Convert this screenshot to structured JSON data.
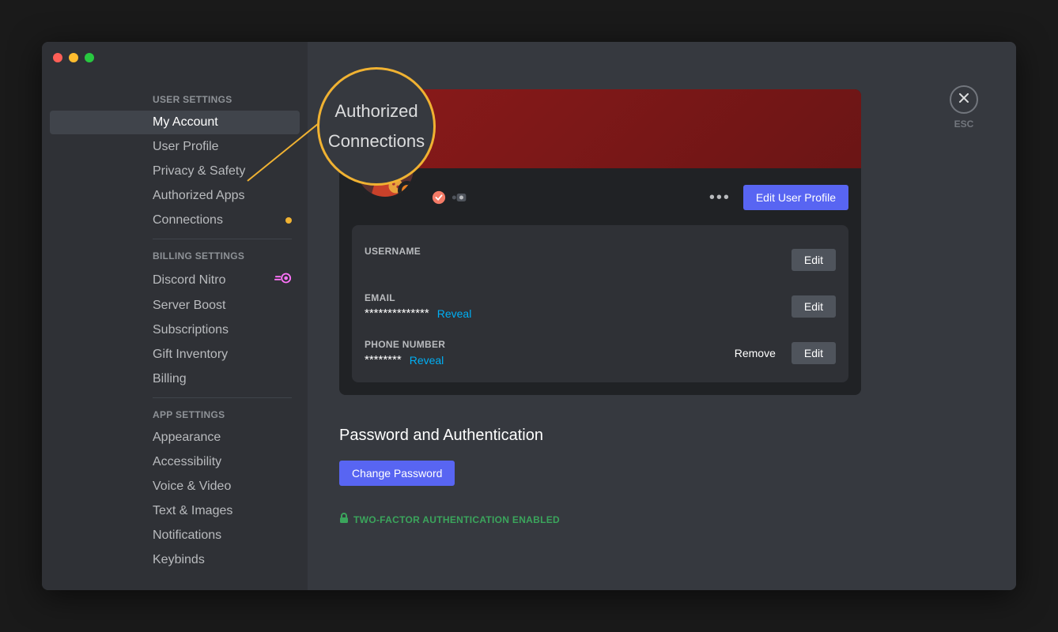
{
  "sidebar": {
    "userSettingsHeader": "User Settings",
    "billingSettingsHeader": "Billing Settings",
    "appSettingsHeader": "App Settings",
    "items": {
      "myAccount": "My Account",
      "userProfile": "User Profile",
      "privacySafety": "Privacy & Safety",
      "authorizedApps": "Authorized Apps",
      "connections": "Connections",
      "discordNitro": "Discord Nitro",
      "serverBoost": "Server Boost",
      "subscriptions": "Subscriptions",
      "giftInventory": "Gift Inventory",
      "billing": "Billing",
      "appearance": "Appearance",
      "accessibility": "Accessibility",
      "voiceVideo": "Voice & Video",
      "textImages": "Text & Images",
      "notifications": "Notifications",
      "keybinds": "Keybinds"
    }
  },
  "close": {
    "esc": "ESC"
  },
  "callout": {
    "line1": "Authorized",
    "line2": "Connections"
  },
  "profile": {
    "editProfileBtn": "Edit User Profile",
    "more": "•••",
    "badges": {
      "b1": "hypesquad-badge-icon",
      "b2": "early-supporter-badge-icon"
    },
    "fields": {
      "usernameLabel": "Username",
      "usernameEditBtn": "Edit",
      "emailLabel": "Email",
      "emailValue": "**************",
      "emailReveal": "Reveal",
      "emailEditBtn": "Edit",
      "phoneLabel": "Phone Number",
      "phoneValue": "********",
      "phoneReveal": "Reveal",
      "phoneRemoveBtn": "Remove",
      "phoneEditBtn": "Edit"
    }
  },
  "password": {
    "sectionTitle": "Password and Authentication",
    "changeBtn": "Change Password",
    "tfa": "Two-factor authentication enabled"
  },
  "colors": {
    "accent": "#5865f2",
    "highlight": "#f0b232",
    "success": "#3ba55c"
  }
}
